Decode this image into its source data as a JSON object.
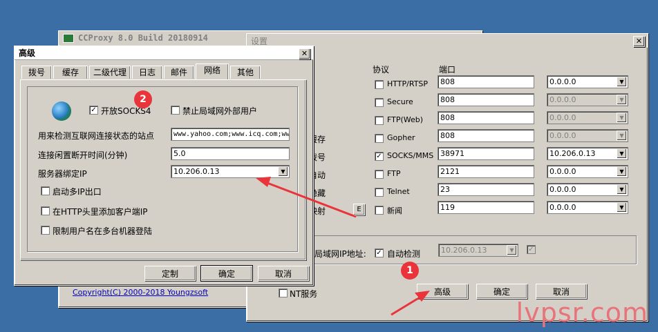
{
  "ccproxy_window": {
    "title": "CCProxy 8.0 Build 20180914",
    "copyright": "Copyright(C) 2000-2018 Youngzsoft"
  },
  "settings_window": {
    "title": "设置",
    "header_protocol": "协议",
    "header_port": "端口",
    "left_labels": [
      "缓存",
      "拨号",
      "自动",
      "隐藏",
      "映射"
    ],
    "map_button": "E",
    "protocols": [
      {
        "name": "HTTP/RTSP",
        "checked": false,
        "port": "808",
        "ip": "0.0.0.0",
        "ip_enabled": true
      },
      {
        "name": "Secure",
        "checked": false,
        "port": "808",
        "ip": "0.0.0.0",
        "ip_enabled": false
      },
      {
        "name": "FTP(Web)",
        "checked": false,
        "port": "808",
        "ip": "0.0.0.0",
        "ip_enabled": false
      },
      {
        "name": "Gopher",
        "checked": false,
        "port": "808",
        "ip": "0.0.0.0",
        "ip_enabled": false
      },
      {
        "name": "SOCKS/MMS",
        "checked": true,
        "port": "38971",
        "ip": "10.206.0.13",
        "ip_enabled": true
      },
      {
        "name": "FTP",
        "checked": false,
        "port": "2121",
        "ip": "0.0.0.0",
        "ip_enabled": true
      },
      {
        "name": "Telnet",
        "checked": false,
        "port": "23",
        "ip": "0.0.0.0",
        "ip_enabled": true
      },
      {
        "name": "新闻",
        "checked": false,
        "port": "119",
        "ip": "0.0.0.0",
        "ip_enabled": true
      }
    ],
    "lan_ip_label": "局域网IP地址:",
    "auto_detect_label": "自动检测",
    "auto_detect_checked": true,
    "lan_ip_value": "10.206.0.13",
    "nt_service_label": "NT服务",
    "advanced_button": "高级",
    "ok_button": "确定",
    "cancel_button": "取消"
  },
  "advanced_window": {
    "title": "高级",
    "tabs": [
      "拨号",
      "缓存",
      "二级代理",
      "日志",
      "邮件",
      "网络",
      "其他"
    ],
    "selected_tab": "网络",
    "enable_socks_label": "开放SOCKS4",
    "enable_socks_checked": true,
    "block_lan_label": "禁止局域网外部用户",
    "block_lan_checked": false,
    "check_site_label": "用来检测互联网连接状态的站点",
    "check_site_value": "www.yahoo.com;www.icq.com;ww",
    "idle_label": "连接闲置断开时间(分钟)",
    "idle_value": "5.0",
    "bind_ip_label": "服务器绑定IP",
    "bind_ip_value": "10.206.0.13",
    "multi_ip_label": "启动多IP出口",
    "http_header_label": "在HTTP头里添加客户端IP",
    "restrict_user_label": "限制用户名在多台机器登陆",
    "custom_button": "定制",
    "ok_button": "确定",
    "cancel_button": "取消"
  },
  "annotations": {
    "badge1": "1",
    "badge2": "2",
    "arrow_color": "#e8343a"
  },
  "watermark": "lvpsr.com"
}
